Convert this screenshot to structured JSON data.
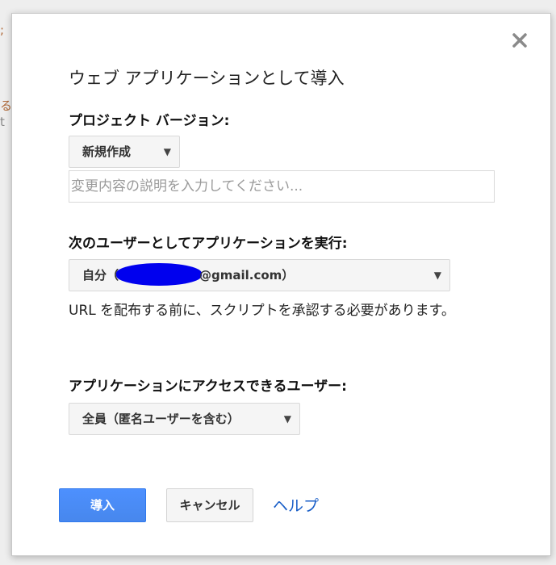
{
  "background": {
    "fragments": [
      ";",
      "る",
      "t"
    ]
  },
  "dialog": {
    "title": "ウェブ アプリケーションとして導入",
    "close_icon": "close-icon",
    "project_version": {
      "label": "プロジェクト バージョン:",
      "selected": "新規作成"
    },
    "description": {
      "value": "",
      "placeholder": "変更内容の説明を入力してください..."
    },
    "execute_as": {
      "label": "次のユーザーとしてアプリケーションを実行:",
      "selected_prefix": "自分（",
      "selected_suffix": "@gmail.com）"
    },
    "note": "URL を配布する前に、スクリプトを承認する必要があります。",
    "access": {
      "label": "アプリケーションにアクセスできるユーザー:",
      "selected": "全員（匿名ユーザーを含む）"
    },
    "buttons": {
      "deploy": "導入",
      "cancel": "キャンセル",
      "help": "ヘルプ"
    }
  },
  "colors": {
    "primary_button": "#4d90fe",
    "link": "#1a5fc8",
    "redaction": "#0000ee"
  }
}
